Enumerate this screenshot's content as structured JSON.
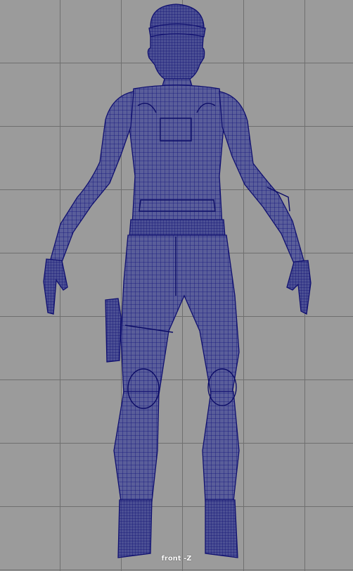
{
  "viewport": {
    "camera_label": "front -Z",
    "background_color": "#9b9b9b",
    "grid_color": "#6f6f6f",
    "wire_color": "#1a1a8f",
    "wire_fill": "#3a3f8c"
  }
}
